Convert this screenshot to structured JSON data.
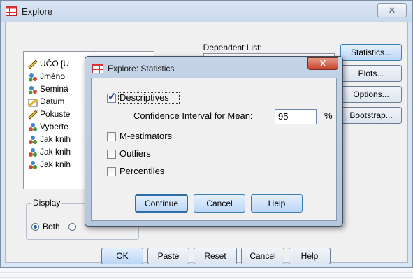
{
  "explore": {
    "title": "Explore",
    "close": "✕",
    "dependent_list_label": "Dependent List:",
    "variables": [
      {
        "label": "UČO [U",
        "icon": "scale-ruler-icon"
      },
      {
        "label": "Jméno",
        "icon": "nominal-person-icon"
      },
      {
        "label": "Seminá",
        "icon": "nominal-person-icon"
      },
      {
        "label": "Datum",
        "icon": "date-icon"
      },
      {
        "label": "Pokuste",
        "icon": "scale-ruler-icon"
      },
      {
        "label": "Vyberte",
        "icon": "nominal-circles-icon"
      },
      {
        "label": "Jak knih",
        "icon": "nominal-circles-icon"
      },
      {
        "label": "Jak knih",
        "icon": "nominal-circles-icon"
      },
      {
        "label": "Jak knih",
        "icon": "nominal-circles-icon"
      }
    ],
    "side_buttons": {
      "statistics": "Statistics...",
      "plots": "Plots...",
      "options": "Options...",
      "bootstrap": "Bootstrap..."
    },
    "display": {
      "legend": "Display",
      "both": "Both",
      "both_selected": true
    },
    "bottom_buttons": {
      "ok": "OK",
      "paste": "Paste",
      "reset": "Reset",
      "cancel": "Cancel",
      "help": "Help"
    }
  },
  "stats_dialog": {
    "title": "Explore: Statistics",
    "close": "X",
    "descriptives": {
      "label": "Descriptives",
      "checked": true
    },
    "ci_label": "Confidence Interval for Mean:",
    "ci_value": "95",
    "ci_unit": "%",
    "m_estimators": {
      "label": "M-estimators",
      "checked": false
    },
    "outliers": {
      "label": "Outliers",
      "checked": false
    },
    "percentiles": {
      "label": "Percentiles",
      "checked": false
    },
    "buttons": {
      "continue": "Continue",
      "cancel": "Cancel",
      "help": "Help"
    }
  },
  "colors": {
    "accent": "#3c7fb1",
    "check": "#1b3f9a",
    "close_red": "#c7412a"
  }
}
